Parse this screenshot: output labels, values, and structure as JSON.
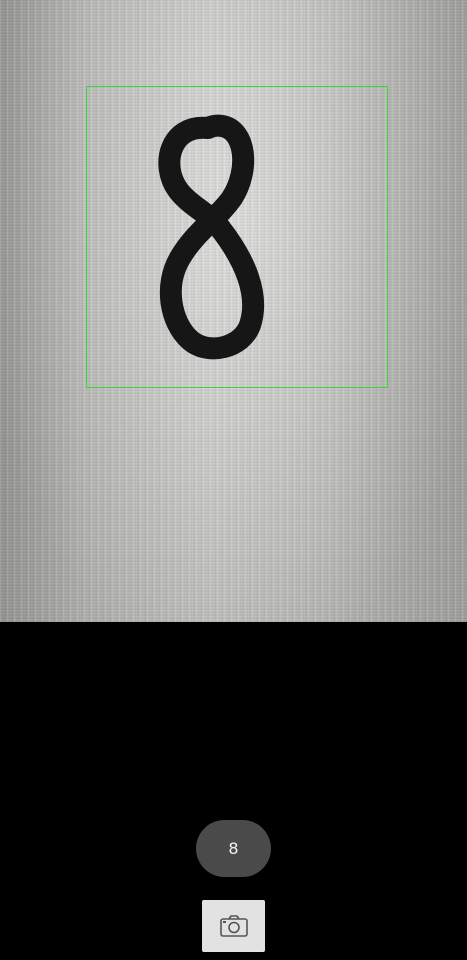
{
  "prediction": {
    "label": "8"
  },
  "capture_button": {
    "icon": "camera-icon"
  },
  "colors": {
    "detection_box": "#3ad33a",
    "pill_background": "#4a4a4a",
    "background": "#000000"
  }
}
